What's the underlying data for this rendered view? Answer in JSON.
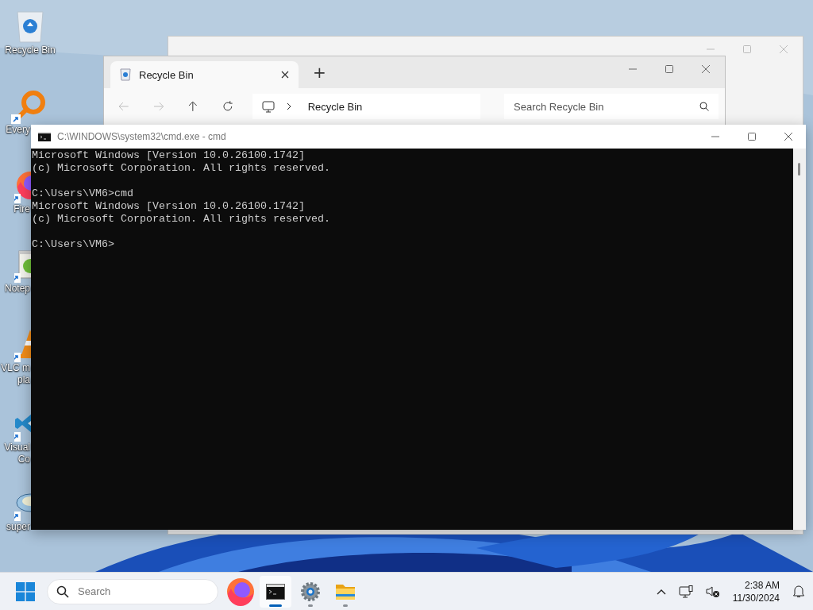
{
  "desktop_icons": [
    {
      "kind": "recycle",
      "lines": [
        "Recycle Bin"
      ],
      "shortcut": false
    },
    {
      "kind": "everything",
      "lines": [
        "Every"
      ],
      "shortcut": true
    },
    {
      "kind": "firefox",
      "lines": [
        "Fire"
      ],
      "shortcut": true
    },
    {
      "kind": "notepad",
      "lines": [
        "Notep"
      ],
      "shortcut": true
    },
    {
      "kind": "vlc",
      "lines": [
        "VLC m",
        "pla"
      ],
      "shortcut": true
    },
    {
      "kind": "vscode",
      "lines": [
        "Visual",
        "Co"
      ],
      "shortcut": true
    },
    {
      "kind": "super",
      "lines": [
        "super"
      ],
      "shortcut": true
    }
  ],
  "explorer": {
    "tab": {
      "title": "Recycle Bin",
      "selected": true
    },
    "new_tab": "+",
    "address": "Recycle Bin",
    "search": {
      "placeholder": "Search Recycle Bin"
    }
  },
  "cmd": {
    "title": "C:\\WINDOWS\\system32\\cmd.exe - cmd",
    "blocks": [
      [
        "Microsoft Windows [Version 10.0.26100.1742]",
        "(c) Microsoft Corporation. All rights reserved."
      ],
      [
        "C:\\Users\\VM6>cmd",
        "Microsoft Windows [Version 10.0.26100.1742]",
        "(c) Microsoft Corporation. All rights reserved."
      ],
      [
        "C:\\Users\\VM6>"
      ]
    ]
  },
  "taskbar": {
    "search": {
      "placeholder": "Search"
    },
    "apps": [
      {
        "kind": "firefox",
        "running": false,
        "selected": false
      },
      {
        "kind": "terminal",
        "running": true,
        "selected": true
      },
      {
        "kind": "settings",
        "running": true,
        "selected": false
      },
      {
        "kind": "explorer",
        "running": true,
        "selected": false
      }
    ],
    "time": "2:38 AM",
    "date": "11/30/2024"
  }
}
